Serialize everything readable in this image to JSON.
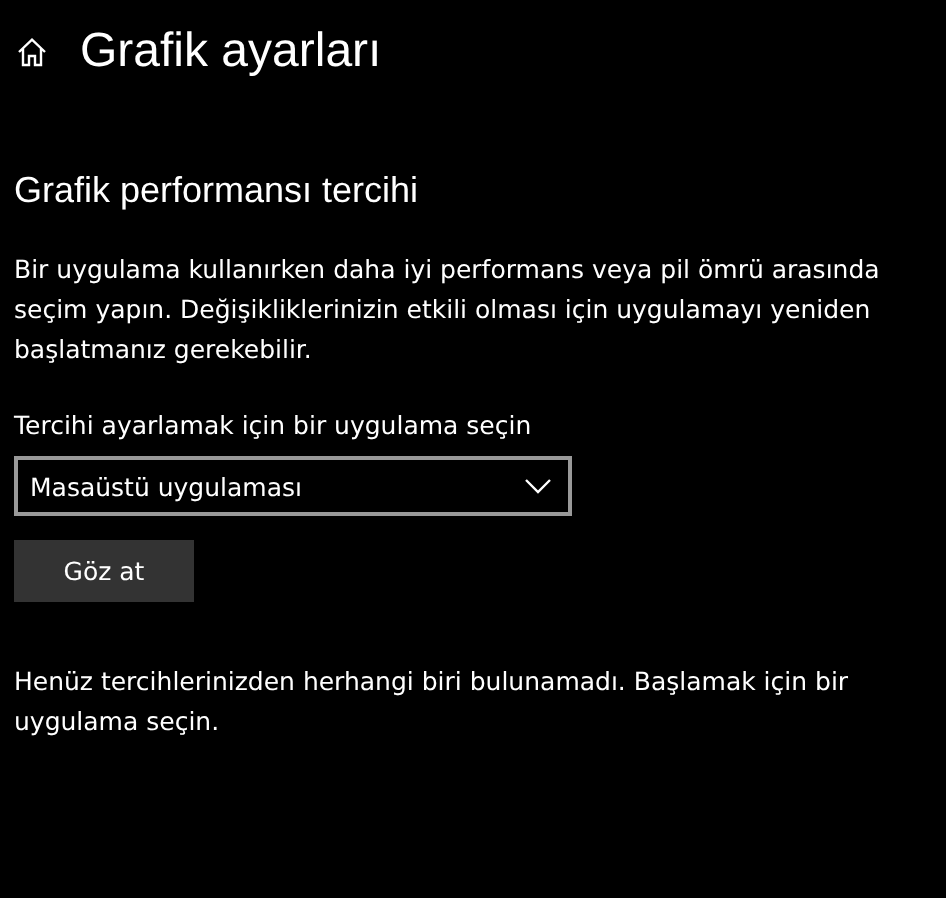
{
  "page": {
    "title": "Grafik ayarları"
  },
  "section": {
    "heading": "Grafik performansı tercihi",
    "description": "Bir uygulama kullanırken daha iyi performans veya pil ömrü arasında seçim yapın. Değişikliklerinizin etkili olması için uygulamayı yeniden başlatmanız gerekebilir."
  },
  "app_picker": {
    "label": "Tercihi ayarlamak için bir uygulama seçin",
    "dropdown": {
      "value": "Masaüstü uygulaması"
    },
    "button": "Göz at"
  },
  "empty_message": "Henüz tercihlerinizden herhangi biri bulunamadı. Başlamak için bir uygulama seçin."
}
